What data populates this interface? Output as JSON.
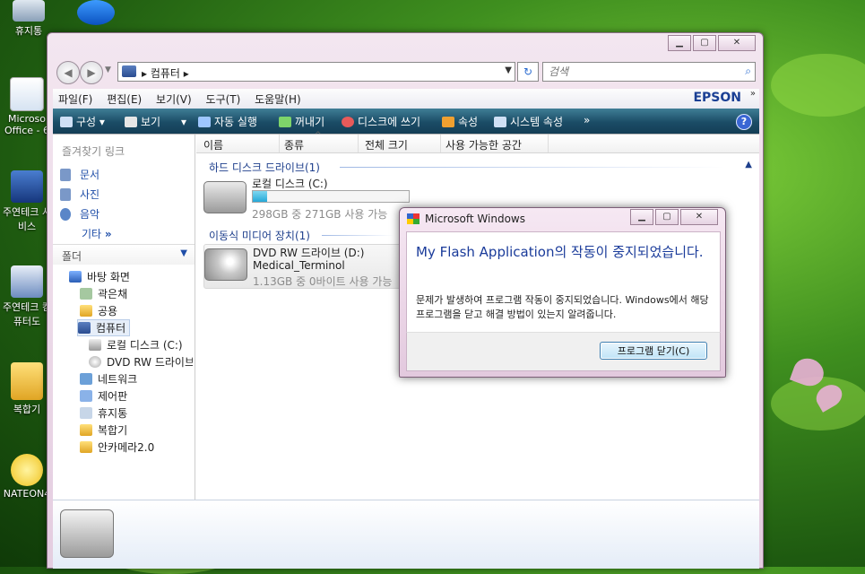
{
  "desktop": {
    "icons": [
      {
        "label": "휴지통"
      },
      {
        "label": "Microso Office - 6"
      },
      {
        "label": "주연테크 서비스"
      },
      {
        "label": "주연테크 컴퓨터도"
      },
      {
        "label": "복합기"
      },
      {
        "label": "NATEON4"
      }
    ]
  },
  "explorer": {
    "address_path": "컴퓨터",
    "search_placeholder": "검색",
    "menus": [
      "파일(F)",
      "편집(E)",
      "보기(V)",
      "도구(T)",
      "도움말(H)"
    ],
    "brand": "EPSON",
    "toolbar": [
      "구성",
      "보기",
      "자동 실행",
      "꺼내기",
      "디스크에 쓰기",
      "속성",
      "시스템 속성"
    ],
    "favorites_heading": "즐겨찾기 링크",
    "favorites": [
      "문서",
      "사진",
      "음악"
    ],
    "more_label": "기타",
    "folders_heading": "폴더",
    "tree": [
      "바탕 화면",
      "곽은채",
      "공용",
      "컴퓨터",
      "로컬 디스크 (C:)",
      "DVD RW 드라이브",
      "네트워크",
      "제어판",
      "휴지통",
      "복합기",
      "안카메라2.0"
    ],
    "columns": [
      "이름",
      "종류",
      "전체 크기",
      "사용 가능한 공간"
    ],
    "groups": {
      "hdd": "하드 디스크 드라이브(1)",
      "removable": "이동식 미디어 장치(1)"
    },
    "drives": {
      "c_name": "로컬 디스크 (C:)",
      "c_info": "298GB 중 271GB 사용 가능",
      "c_used_fraction": 0.09,
      "d_name": "DVD RW 드라이브 (D:)",
      "d_label": "Medical_Terminol",
      "d_info": "1.13GB 중 0바이트 사용 가능"
    }
  },
  "dialog": {
    "title": "Microsoft Windows",
    "main_instruction": "My Flash Application의 작동이 중지되었습니다.",
    "message": "문제가 발생하여 프로그램 작동이 중지되었습니다. Windows에서 해당 프로그램을 닫고 해결 방법이 있는지 알려줍니다.",
    "close_button": "프로그램 닫기(C)"
  },
  "colors": {
    "toolbar": "#1b4c66",
    "link": "#1f4ea8",
    "instruction": "#1a3b9a"
  }
}
